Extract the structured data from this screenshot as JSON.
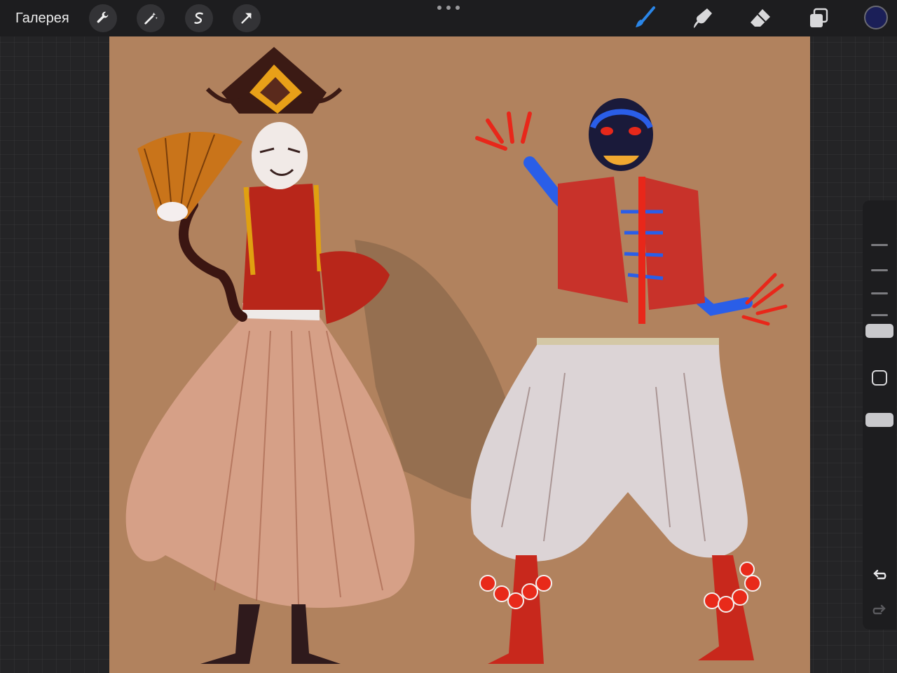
{
  "app": {
    "accent": "#2a86e8",
    "canvas_bg": "#b1825e",
    "current_color": "#1b1f58"
  },
  "topbar": {
    "gallery_label": "Галерея",
    "left_tools": [
      "wrench-icon",
      "magic-wand-icon",
      "selection-icon",
      "transform-arrow-icon"
    ],
    "right_tools": [
      "brush-icon",
      "smudge-icon",
      "eraser-icon",
      "layers-icon"
    ],
    "active_tool": "brush-icon"
  },
  "sidebar": {
    "controls": [
      "brush-size-slider",
      "modify-button",
      "opacity-slider",
      "undo-button",
      "redo-button"
    ]
  }
}
